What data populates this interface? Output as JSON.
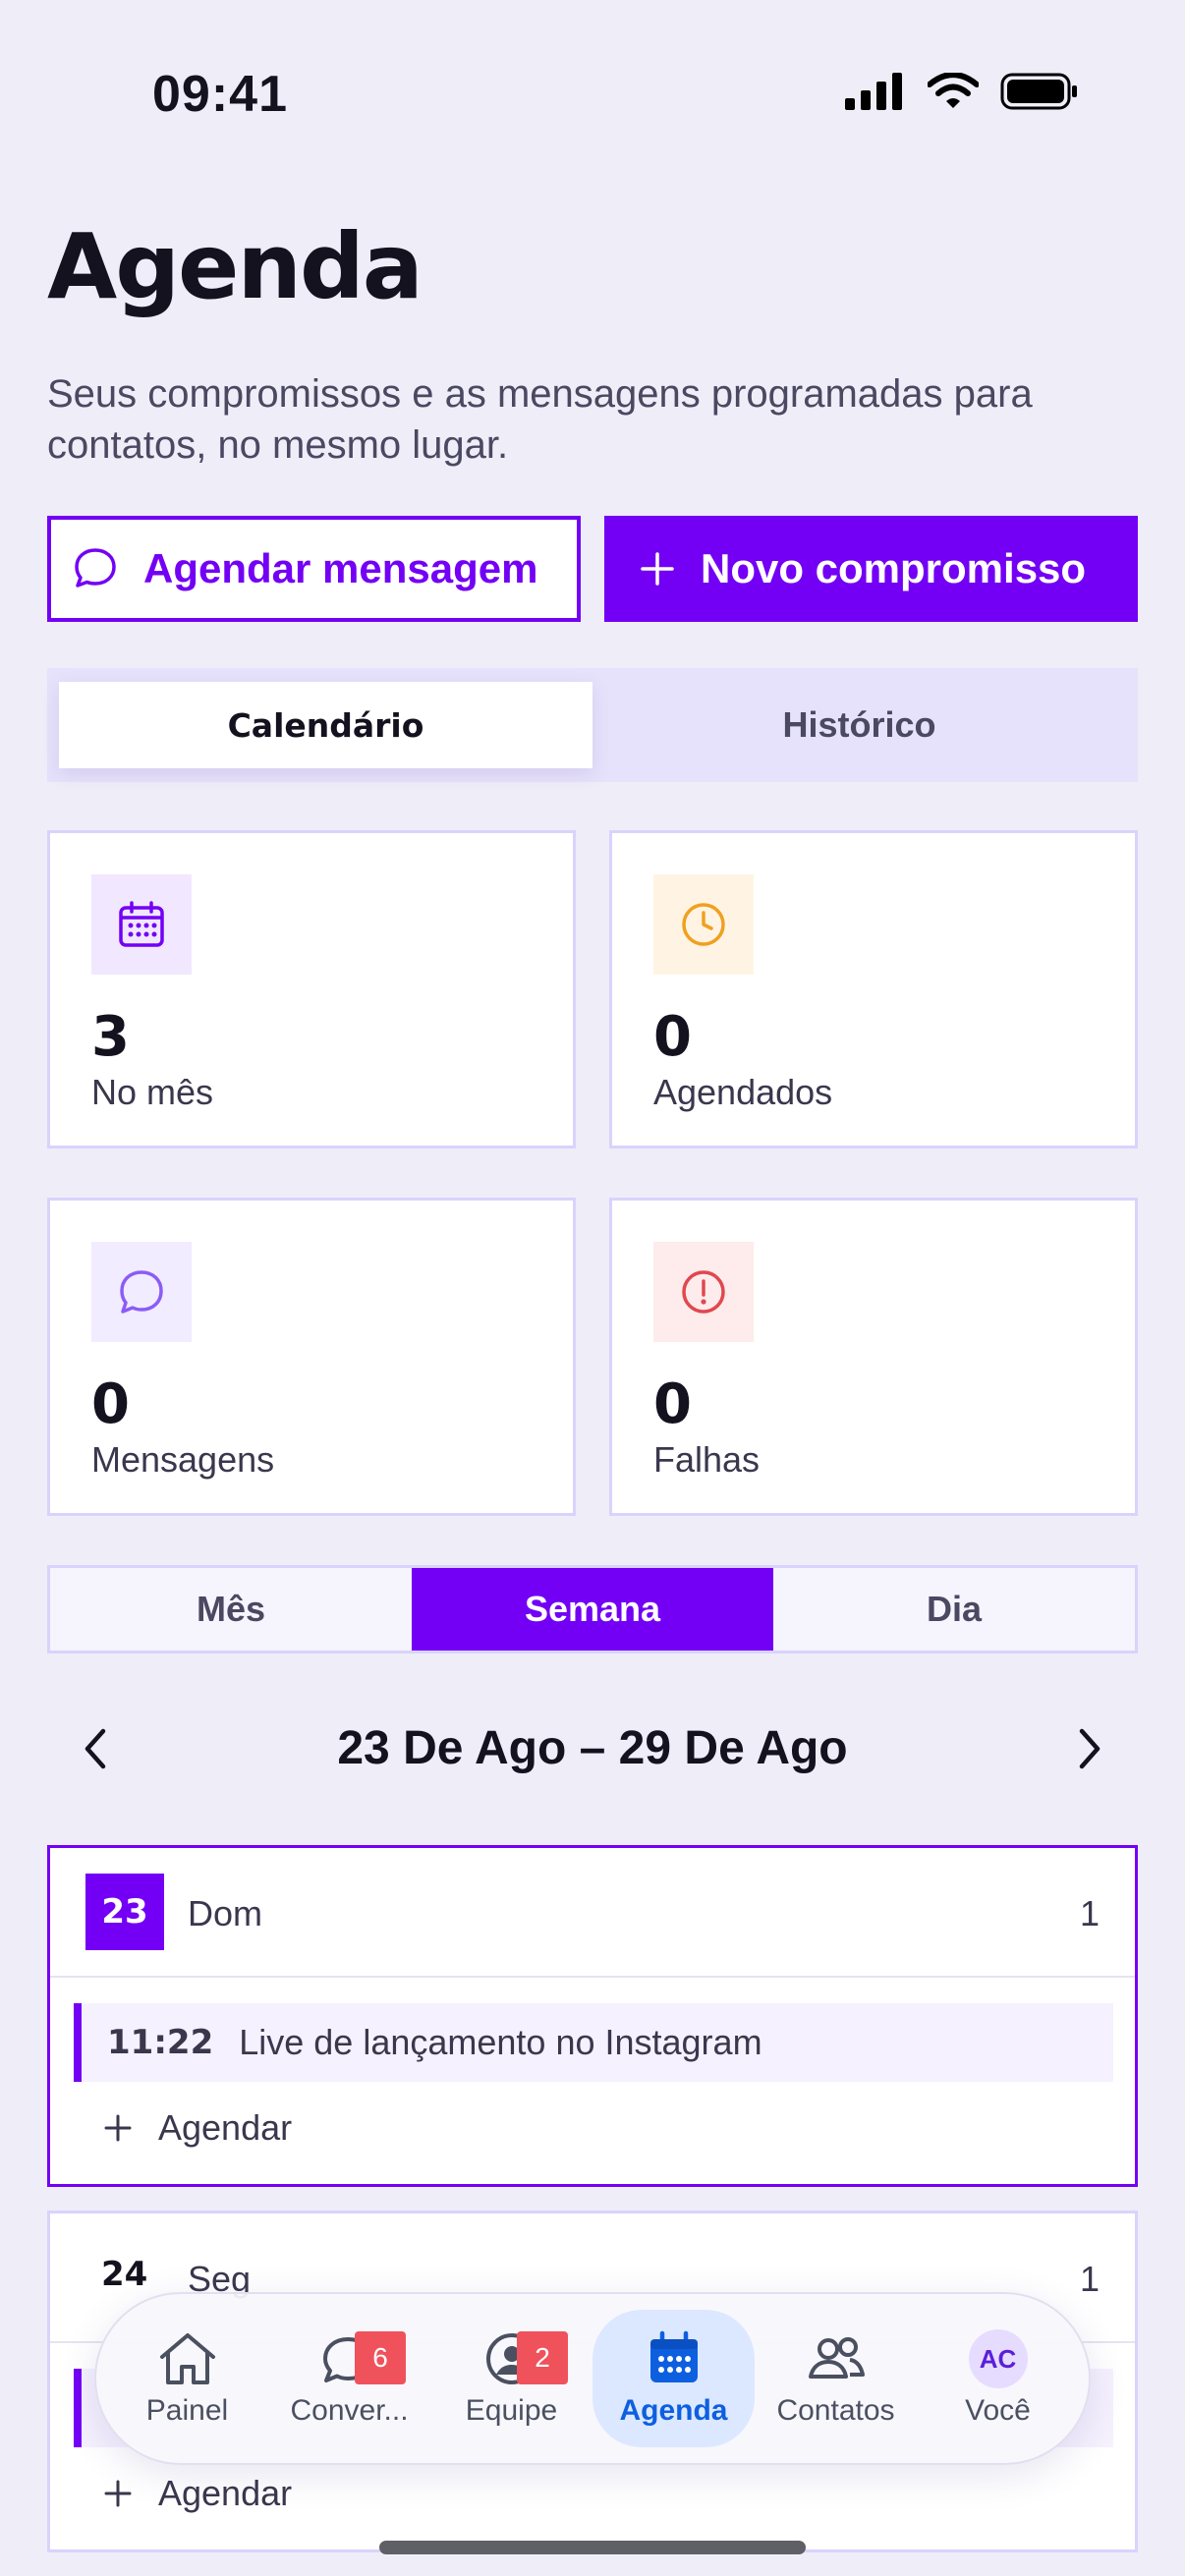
{
  "status_bar": {
    "time": "09:41"
  },
  "header": {
    "title": "Agenda",
    "subtitle": "Seus compromissos e as mensagens programadas para contatos, no mesmo lugar."
  },
  "actions": {
    "schedule_message": "Agendar mensagem",
    "new_appointment": "Novo compromisso"
  },
  "tabs": [
    {
      "label": "Calendário",
      "active": true
    },
    {
      "label": "Histórico",
      "active": false
    }
  ],
  "stats": [
    {
      "value": "3",
      "label": "No mês",
      "icon": "calendar-icon",
      "color": "#7300f5",
      "bg": "#f1e8ff"
    },
    {
      "value": "0",
      "label": "Agendados",
      "icon": "clock-icon",
      "color": "#f0a020",
      "bg": "#fff4e4"
    },
    {
      "value": "0",
      "label": "Mensagens",
      "icon": "chat-bubble-icon",
      "color": "#8b5cf6",
      "bg": "#f1ecff"
    },
    {
      "value": "0",
      "label": "Falhas",
      "icon": "alert-icon",
      "color": "#e0484f",
      "bg": "#fdeceb"
    }
  ],
  "views": [
    {
      "label": "Mês",
      "active": false
    },
    {
      "label": "Semana",
      "active": true
    },
    {
      "label": "Dia",
      "active": false
    }
  ],
  "week": {
    "label": "23 De Ago – 29 De Ago"
  },
  "days": [
    {
      "num": "23",
      "name": "Dom",
      "count": "1",
      "today": true,
      "events": [
        {
          "time": "11:22",
          "title": "Live de lançamento no Instagram"
        }
      ],
      "add_label": "Agendar"
    },
    {
      "num": "24",
      "name": "Seg",
      "count": "1",
      "today": false,
      "add_label": "Agendar"
    }
  ],
  "tabbar": [
    {
      "label": "Painel",
      "icon": "home-icon"
    },
    {
      "label": "Conver...",
      "icon": "chat-icon",
      "badge": "6"
    },
    {
      "label": "Equipe",
      "icon": "team-icon",
      "badge": "2"
    },
    {
      "label": "Agenda",
      "icon": "calendar-icon",
      "active": true
    },
    {
      "label": "Contatos",
      "icon": "contacts-icon"
    },
    {
      "label": "Você",
      "icon": "avatar",
      "avatar_initials": "AC"
    }
  ],
  "colors": {
    "accent": "#7300f5",
    "active_tab": "#0d5fe0",
    "badge": "#f0525c"
  }
}
